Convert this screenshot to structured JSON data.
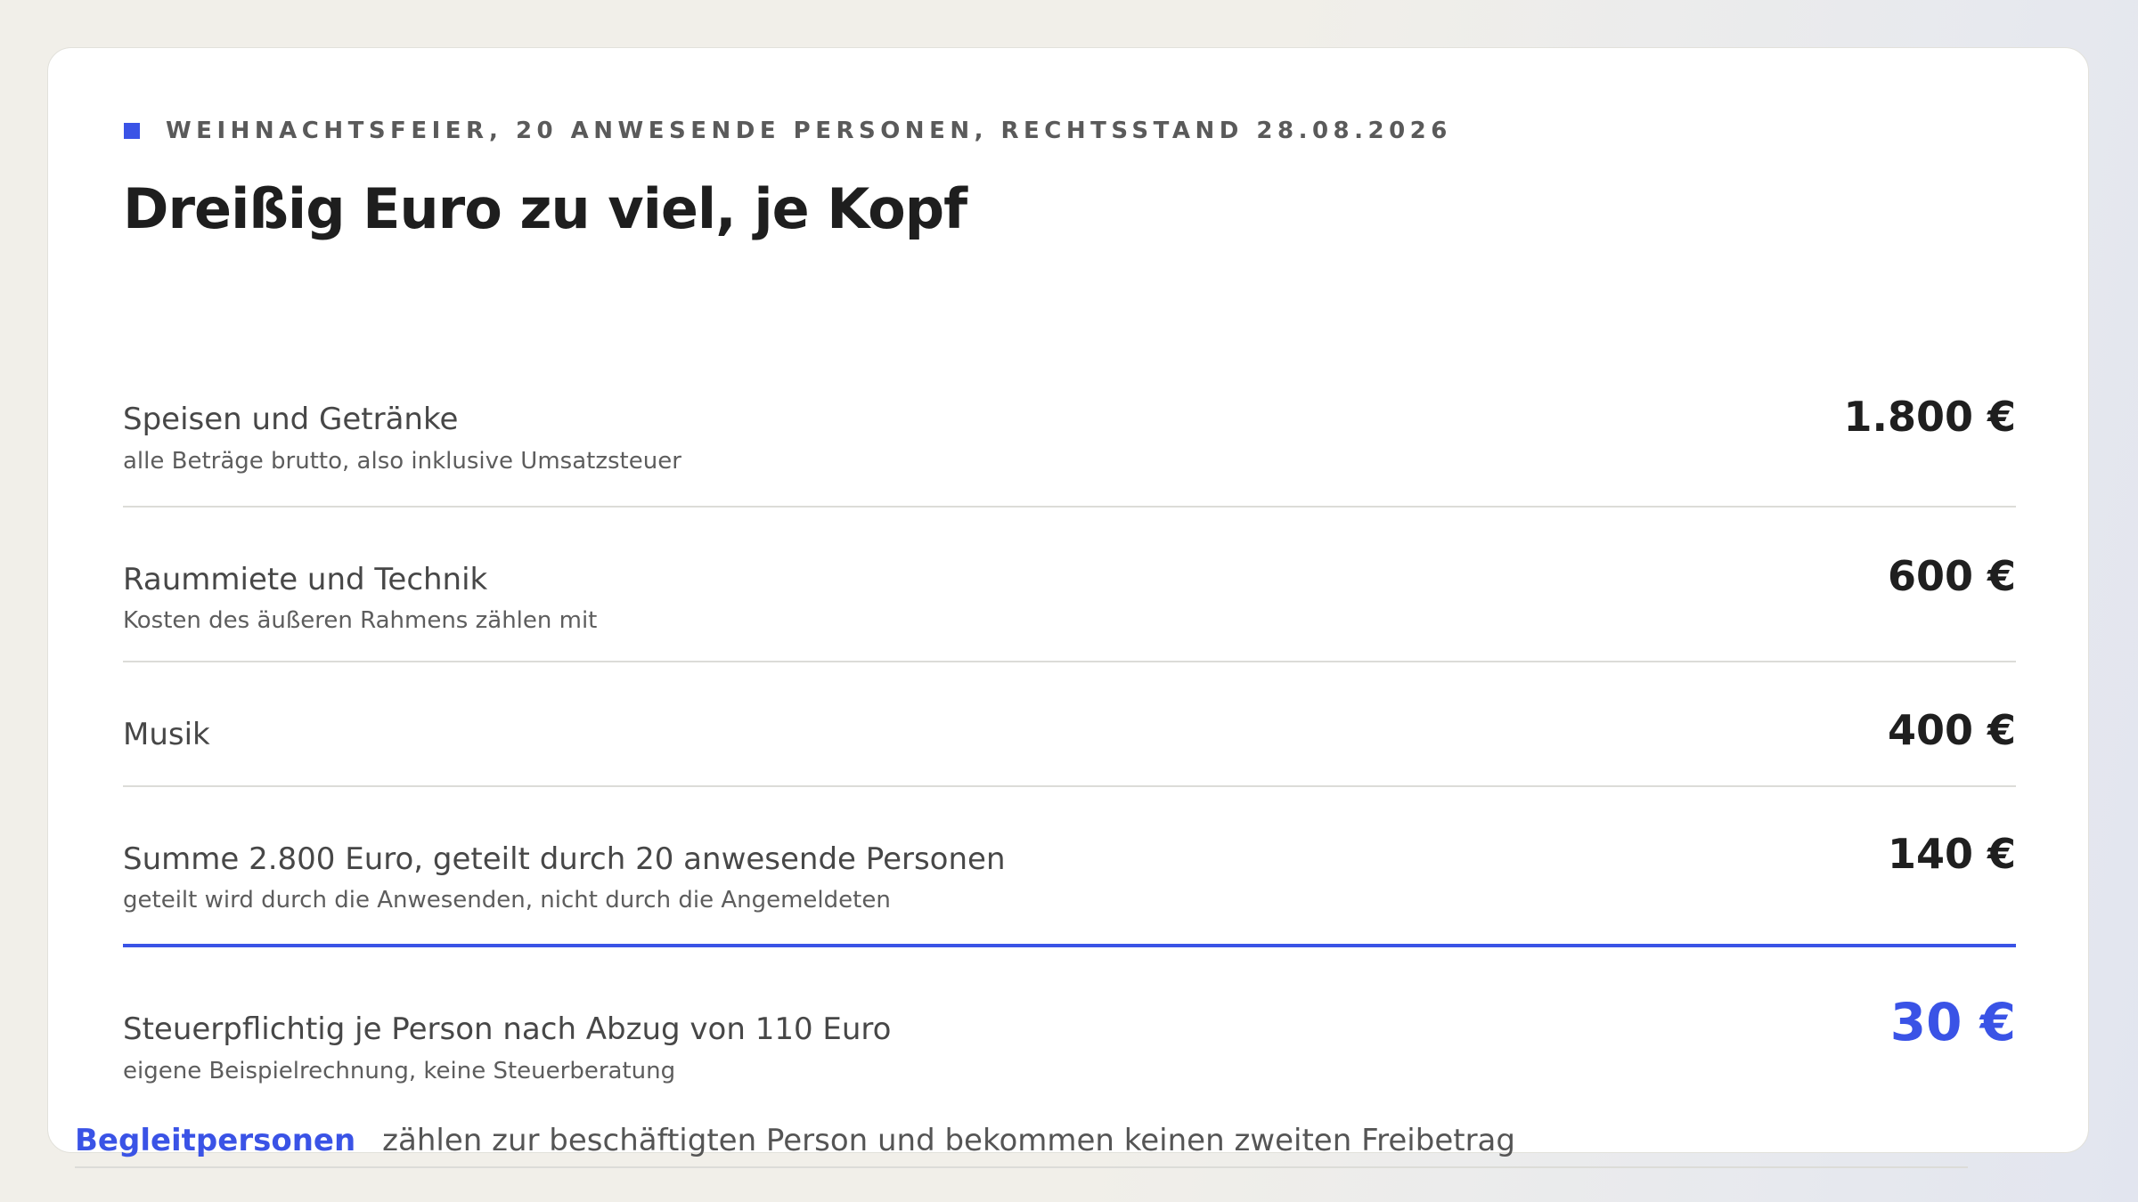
{
  "header": {
    "eyebrow": "WEIHNACHTSFEIER, 20 ANWESENDE PERSONEN, RECHTSSTAND 28.08.2026",
    "title": "Dreißig Euro zu viel, je Kopf"
  },
  "rows": [
    {
      "label": "Speisen und Getränke",
      "note": "alle Beträge brutto, also inklusive Umsatzsteuer",
      "value": "1.800 €"
    },
    {
      "label": "Raummiete und Technik",
      "note": "Kosten des äußeren Rahmens zählen mit",
      "value": "600 €"
    },
    {
      "label": "Musik",
      "value": "400 €"
    },
    {
      "label": "Summe 2.800 Euro, geteilt durch 20 anwesende Personen",
      "note": "geteilt wird durch die Anwesenden, nicht durch die Angemeldeten",
      "value": "140 €"
    },
    {
      "label": "Steuerpflichtig je Person nach Abzug von 110 Euro",
      "note": "eigene Beispielrechnung, keine Steuerberatung",
      "value": "30 €"
    }
  ],
  "footer": {
    "key": "Begleitpersonen",
    "text": "zählen zur beschäftigten Person und bekommen keinen zweiten Freibetrag"
  },
  "colors": {
    "accent": "#3a53e6",
    "background": "#f1efe9",
    "card": "#ffffff"
  }
}
